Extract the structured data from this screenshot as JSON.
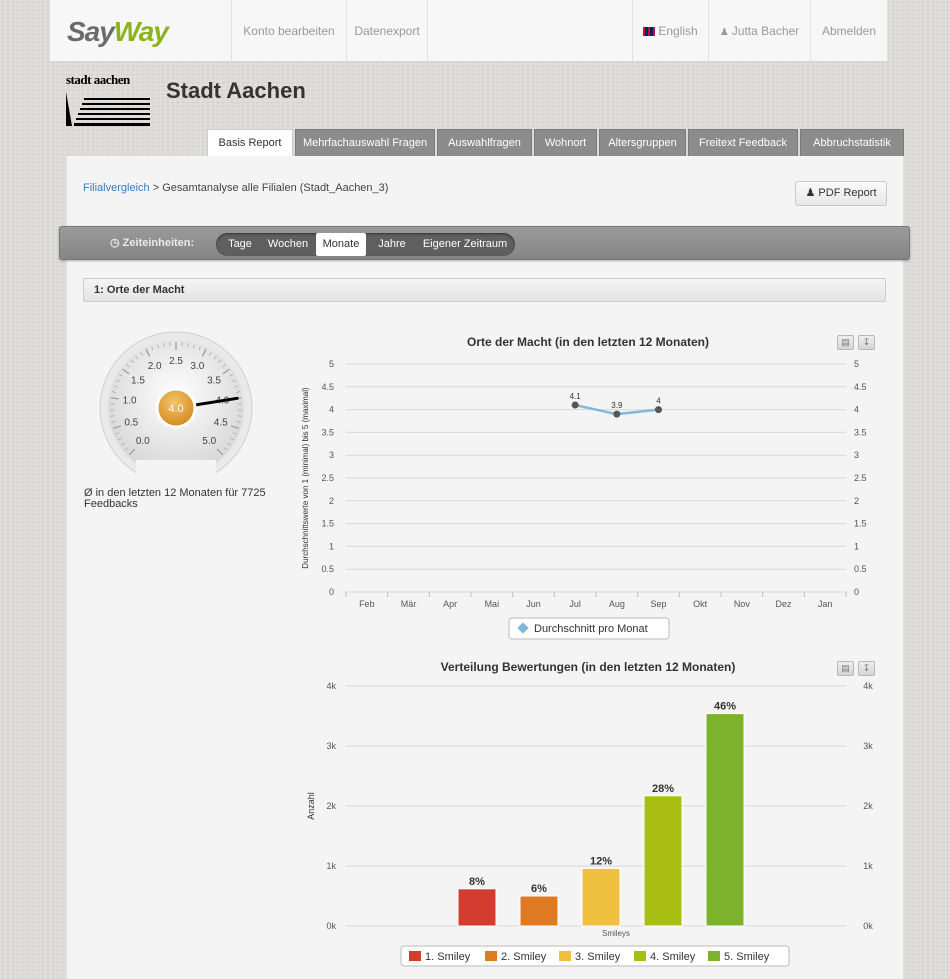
{
  "app": {
    "logo_say": "Say",
    "logo_way": "Way"
  },
  "topnav": {
    "edit_account": "Konto bearbeiten",
    "data_export": "Datenexport",
    "language": "English",
    "user": "Jutta Bacher",
    "logout": "Abmelden"
  },
  "brand": {
    "logo_text": "stadt aachen",
    "title": "Stadt Aachen"
  },
  "tabs": [
    "Basis Report",
    "Mehrfachauswahl Fragen",
    "Auswahlfragen",
    "Wohnort",
    "Altersgruppen",
    "Freitext Feedback",
    "Abbruchstatistik"
  ],
  "breadcrumb": {
    "link": "Filialvergleich",
    "sep": ">",
    "current": "Gesamtanalyse alle Filialen (Stadt_Aachen_3)"
  },
  "pdf_button": "PDF Report",
  "time_units": {
    "label": "Zeiteinheiten:",
    "options": [
      "Tage",
      "Wochen",
      "Monate",
      "Jahre",
      "Eigener Zeitraum"
    ],
    "selected": "Monate"
  },
  "section": {
    "title": "1: Orte der Macht"
  },
  "gauge": {
    "value": 4.0,
    "display": "4.0",
    "min": 0,
    "max": 5,
    "ticks": [
      "0.0",
      "0.5",
      "1.0",
      "1.5",
      "2.0",
      "2.5",
      "3.0",
      "3.5",
      "4.0",
      "4.5",
      "5.0"
    ],
    "note": "Ø in den letzten 12 Monaten für 7725 Feedbacks"
  },
  "colors": {
    "line": "#7fb8d8",
    "smiley1": "#d33c2f",
    "smiley2": "#e07a22",
    "smiley3": "#f0c040",
    "smiley4": "#a9be12",
    "smiley5": "#7db22d",
    "gauge_center": "#e8a339"
  },
  "chart_data": [
    {
      "type": "line",
      "title": "Orte der Macht (in den letzten 12 Monaten)",
      "ylabel": "Durchschnittswerte von 1 (minimal) bis 5 (maximal)",
      "categories": [
        "Feb",
        "Mär",
        "Apr",
        "Mai",
        "Jun",
        "Jul",
        "Aug",
        "Sep",
        "Okt",
        "Nov",
        "Dez",
        "Jan"
      ],
      "yticks": [
        "0",
        "0.5",
        "1",
        "1.5",
        "2",
        "2.5",
        "3",
        "3.5",
        "4",
        "4.5",
        "5"
      ],
      "ylim": [
        0,
        5
      ],
      "series": [
        {
          "name": "Durchschnitt pro Monat",
          "values": [
            null,
            null,
            null,
            null,
            null,
            4.1,
            3.9,
            4.0,
            null,
            null,
            null,
            null
          ],
          "labels": [
            null,
            null,
            null,
            null,
            null,
            "4.1",
            "3.9",
            "4",
            null,
            null,
            null,
            null
          ]
        }
      ],
      "legend": "bottom-center",
      "grid": true
    },
    {
      "type": "bar",
      "title": "Verteilung Bewertungen (in den letzten 12 Monaten)",
      "xlabel": "Smileys",
      "ylabel": "Anzahl",
      "yticks": [
        "0k",
        "1k",
        "2k",
        "3k",
        "4k"
      ],
      "ylim": [
        0,
        4000
      ],
      "categories": [
        "1. Smiley",
        "2. Smiley",
        "3. Smiley",
        "4. Smiley",
        "5. Smiley"
      ],
      "values": [
        620,
        500,
        960,
        2170,
        3540
      ],
      "labels": [
        "8%",
        "6%",
        "12%",
        "28%",
        "46%"
      ],
      "legend": "bottom-center",
      "grid": true
    }
  ]
}
